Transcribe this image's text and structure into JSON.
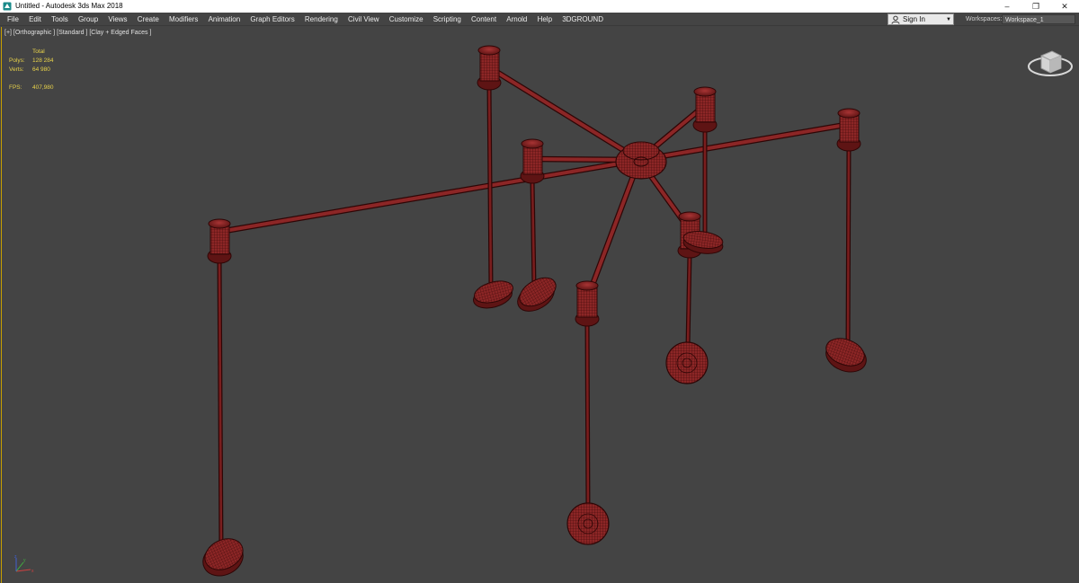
{
  "window": {
    "title": "Untitled - Autodesk 3ds Max 2018",
    "minimize": "–",
    "restore": "❐",
    "close": "✕"
  },
  "menu": {
    "items": [
      "File",
      "Edit",
      "Tools",
      "Group",
      "Views",
      "Create",
      "Modifiers",
      "Animation",
      "Graph Editors",
      "Rendering",
      "Civil View",
      "Customize",
      "Scripting",
      "Content",
      "Arnold",
      "Help",
      "3DGROUND"
    ]
  },
  "account": {
    "signin_label": "Sign In",
    "workspaces_label": "Workspaces:",
    "workspace_value": "Workspace_1"
  },
  "viewport": {
    "label": "[+] [Orthographic ] [Standard ] [Clay + Edged Faces ]",
    "stats": {
      "header": "Total",
      "polys_label": "Polys:",
      "polys_value": "128 284",
      "verts_label": "Verts:",
      "verts_value": "64 980",
      "fps_label": "FPS:",
      "fps_value": "407,980"
    },
    "axis_labels": {
      "x": "x",
      "y": "y",
      "z": "z"
    }
  },
  "colors": {
    "mesh_fill": "#8c2626",
    "mesh_edge": "#2e0606",
    "viewport_bg": "#444444",
    "stats_text": "#e8d24a",
    "active_border": "#c8a000"
  },
  "icons": {
    "app": "3dsmax-icon",
    "user": "user-icon",
    "dropdown": "chevron-down-icon",
    "viewcube": "viewcube-icon",
    "axis": "axis-tripod-icon"
  }
}
